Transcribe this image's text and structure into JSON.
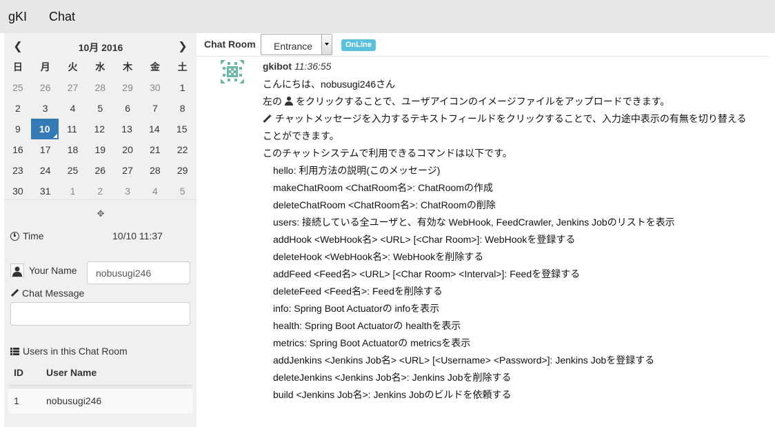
{
  "navbar": {
    "brand": "gKI",
    "chat_link": "Chat"
  },
  "calendar": {
    "title": "10月 2016",
    "weekdays": [
      "日",
      "月",
      "火",
      "水",
      "木",
      "金",
      "土"
    ],
    "weeks": [
      [
        "25",
        "26",
        "27",
        "28",
        "29",
        "30",
        "1"
      ],
      [
        "2",
        "3",
        "4",
        "5",
        "6",
        "7",
        "8"
      ],
      [
        "9",
        "10",
        "11",
        "12",
        "13",
        "14",
        "15"
      ],
      [
        "16",
        "17",
        "18",
        "19",
        "20",
        "21",
        "22"
      ],
      [
        "23",
        "24",
        "25",
        "26",
        "27",
        "28",
        "29"
      ],
      [
        "30",
        "31",
        "1",
        "2",
        "3",
        "4",
        "5"
      ]
    ],
    "selected": "10"
  },
  "sidebar": {
    "time_label": "Time",
    "time_value": "10/10 11:37",
    "your_name_label": "Your Name",
    "your_name_value": "nobusugi246",
    "chat_message_label": "Chat Message",
    "chat_message_value": "",
    "users_title": "Users in this Chat Room",
    "table": {
      "headers": [
        "ID",
        "User Name"
      ],
      "rows": [
        [
          "1",
          "nobusugi246"
        ]
      ]
    }
  },
  "chat": {
    "room_label": "Chat Room",
    "room_selected": "Entrance",
    "status": "OnLine",
    "message": {
      "author": "gkibot",
      "time": "11:36:55",
      "greeting": "こんにちは、nobusugi246さん",
      "line_avatar_a": "左の",
      "line_avatar_b": "をクリックすることで、ユーザアイコンのイメージファイルをアップロードできます。",
      "line_pencil": "チャットメッセージを入力するテキストフィールドをクリックすることで、入力途中表示の有無を切り替える",
      "line_pencil_cont": "ことができます。",
      "commands_intro": "このチャットシステムで利用できるコマンドは以下です。",
      "commands": [
        "hello: 利用方法の説明(このメッセージ)",
        "makeChatRoom <ChatRoom名>: ChatRoomの作成",
        "deleteChatRoom <ChatRoom名>: ChatRoomの削除",
        "users: 接続している全ユーザと、有効な WebHook, FeedCrawler, Jenkins Jobのリストを表示",
        "addHook <WebHook名> <URL> [<Char Room>]: WebHookを登録する",
        "deleteHook <WebHook名>: WebHookを削除する",
        "addFeed <Feed名> <URL> [<Char Room> <Interval>]: Feedを登録する",
        "deleteFeed <Feed名>: Feedを削除する",
        "info: Spring Boot Actuatorの infoを表示",
        "health: Spring Boot Actuatorの healthを表示",
        "metrics: Spring Boot Actuatorの metricsを表示",
        "addJenkins <Jenkins Job名> <URL> [<Username> <Password>]: Jenkins Jobを登録する",
        "deleteJenkins <Jenkins Job名>: Jenkins Jobを削除する",
        "build <Jenkins Job名>: Jenkins Jobのビルドを依頼する"
      ]
    }
  }
}
